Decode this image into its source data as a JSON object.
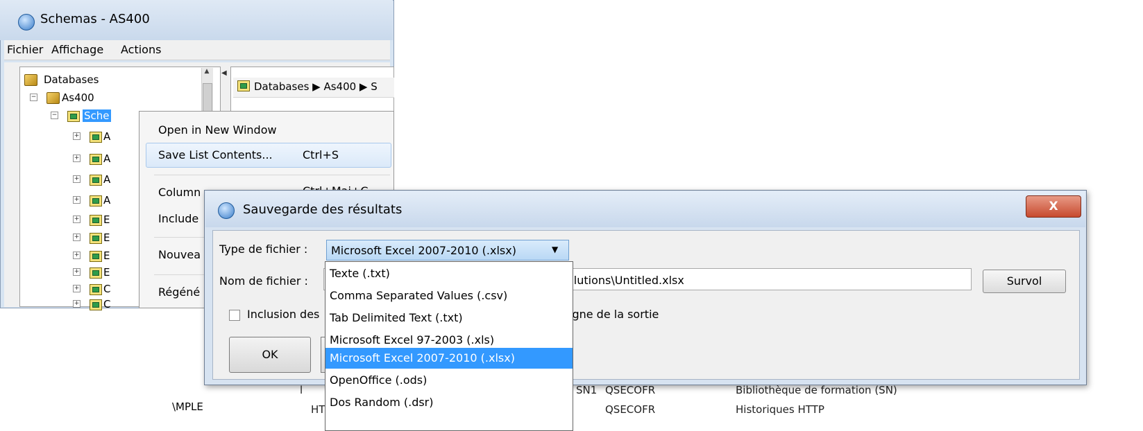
{
  "back_window": {
    "title": "Schemas - AS400",
    "menu": [
      "Fichier",
      "Affichage",
      "Actions"
    ],
    "tree": {
      "root_label": "Databases",
      "db_label": "As400",
      "schemas_label": "Sche",
      "child_labels": [
        "A",
        "A",
        "A",
        "A",
        "E",
        "E",
        "E",
        "E",
        "C",
        "C"
      ]
    },
    "breadcrumb": "Databases ▶ As400 ▶ S",
    "bottom_left_text": "\\MPLE"
  },
  "context_menu": {
    "items": [
      {
        "label": "Open in New Window",
        "shortcut": ""
      },
      {
        "label": "Save List Contents...",
        "shortcut": "Ctrl+S"
      },
      {
        "label": "Column",
        "shortcut": "Ctrl+Maj+C"
      },
      {
        "label": "Include",
        "shortcut": ""
      },
      {
        "label": "Nouvea",
        "shortcut": ""
      },
      {
        "label": "Régéné",
        "shortcut": ""
      }
    ]
  },
  "background_rows": [
    {
      "c1": "l",
      "c2": "SN1",
      "c3": "QSECOFR",
      "c4": "Bibliothèque de formation (SN)"
    },
    {
      "c1": "HT",
      "c2": "",
      "c3": "QSECOFR",
      "c4": "Historiques HTTP"
    }
  ],
  "dialog": {
    "title": "Sauvegarde des résultats",
    "close_label": "X",
    "file_type_label": "Type de fichier :",
    "file_type_value": "Microsoft Excel 2007-2010 (.xlsx)",
    "file_name_label": "Nom de fichier :",
    "file_name_value": "olutions\\Untitled.xlsx",
    "browse_label": "Survol",
    "include_label_start": "Inclusion des",
    "include_label_end": "igne de la sortie",
    "ok_label": "OK"
  },
  "dropdown": {
    "options": [
      "Texte (.txt)",
      "Comma Separated Values (.csv)",
      "Tab Delimited Text (.txt)",
      "Microsoft Excel 97-2003 (.xls)",
      "Microsoft Excel 2007-2010 (.xlsx)",
      "OpenOffice (.ods)",
      "Dos Random (.dsr)"
    ],
    "selected_index": 4
  },
  "colors": {
    "selection": "#3399ff",
    "window_frame": "#d7e4f2",
    "close_button": "#c74a2f"
  }
}
